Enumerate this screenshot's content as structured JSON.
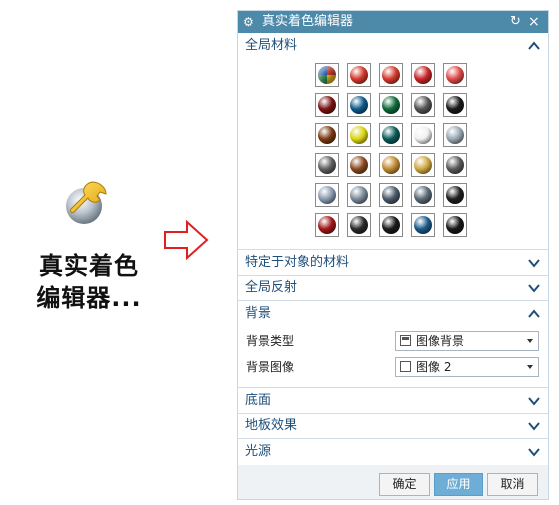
{
  "launcher": {
    "label_line1": "真实着色",
    "label_line2": "编辑器..."
  },
  "dialog": {
    "title": "真实着色编辑器",
    "sections": {
      "global_materials": "全局材料",
      "object_materials": "特定于对象的材料",
      "global_reflection": "全局反射",
      "background": "背景",
      "bottom": "底面",
      "floor_effects": "地板效果",
      "light_source": "光源"
    },
    "background": {
      "type_label": "背景类型",
      "type_value": "图像背景",
      "image_label": "背景图像",
      "image_value": "图像 2"
    },
    "buttons": {
      "ok": "确定",
      "apply": "应用",
      "cancel": "取消"
    }
  },
  "colors": {
    "titlebar": "#4d8aa9",
    "section_text": "#1e4f7a",
    "apply_button": "#6eaed6",
    "arrow": "#e02020"
  },
  "materials": [
    [
      "multicolor",
      "#d33a2c",
      "#d33a2c",
      "#c8262a",
      "#e04a4a"
    ],
    [
      "#7a1414",
      "#0e5a8a",
      "#0e6a3a",
      "#555555",
      "#1a1a1a"
    ],
    [
      "#7a3a10",
      "#d8d410",
      "#0a5a5a",
      "#f0f0f0",
      "#9aa8b4"
    ],
    [
      "#606060",
      "#8a4a20",
      "#c08a30",
      "#d0a840",
      "#5a5a5a"
    ],
    [
      "#8a9ab0",
      "#7a8a9a",
      "#4a5a6a",
      "#5a6a78",
      "#202020"
    ],
    [
      "#a01818",
      "#2a2a2a",
      "#1a1a1a",
      "#1a5a8a",
      "#181818"
    ]
  ]
}
